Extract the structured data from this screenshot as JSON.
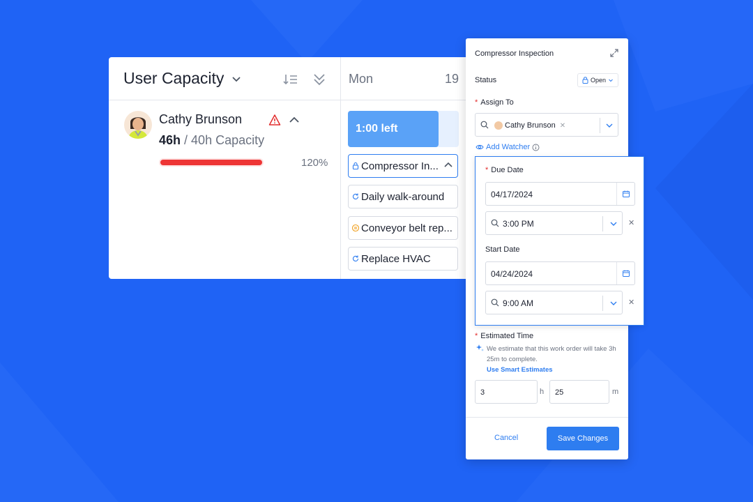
{
  "capacity": {
    "title": "User Capacity",
    "day_label": "Mon",
    "day_number": "19",
    "user": {
      "name": "Cathy Brunson",
      "hours": "46h",
      "capacity_text": "/ 40h Capacity",
      "percent": "120%",
      "percent_value": 120
    },
    "time_left_label": "1:00 left",
    "time_left_fraction": 0.82,
    "work_orders": [
      {
        "label": "Compressor In...",
        "icon": "lock-icon"
      },
      {
        "label": "Daily walk-around",
        "icon": "refresh-icon"
      },
      {
        "label": "Conveyor belt rep...",
        "icon": "pause-icon"
      },
      {
        "label": "Replace HVAC",
        "icon": "refresh-icon"
      }
    ]
  },
  "panel": {
    "title": "Compressor Inspection",
    "status_label": "Status",
    "status_value": "Open",
    "assign_label": "Assign To",
    "assignee": "Cathy Brunson",
    "add_watcher": "Add Watcher",
    "due_date_label": "Due Date",
    "due_date": "04/17/2024",
    "due_time": "3:00 PM",
    "start_date_label": "Start Date",
    "start_date": "04/24/2024",
    "start_time": "9:00 AM",
    "estimated_label": "Estimated Time",
    "estimate_note": "We estimate that this work order will take 3h 25m to complete.",
    "smart_estimates": "Use Smart Estimates",
    "hours_value": "3",
    "hours_unit": "h",
    "minutes_value": "25",
    "minutes_unit": "m",
    "cancel": "Cancel",
    "save": "Save Changes"
  },
  "colors": {
    "background": "#1f63f5",
    "accent": "#2e7df0",
    "danger": "#ee3535",
    "chip": "#5aa2f7"
  }
}
